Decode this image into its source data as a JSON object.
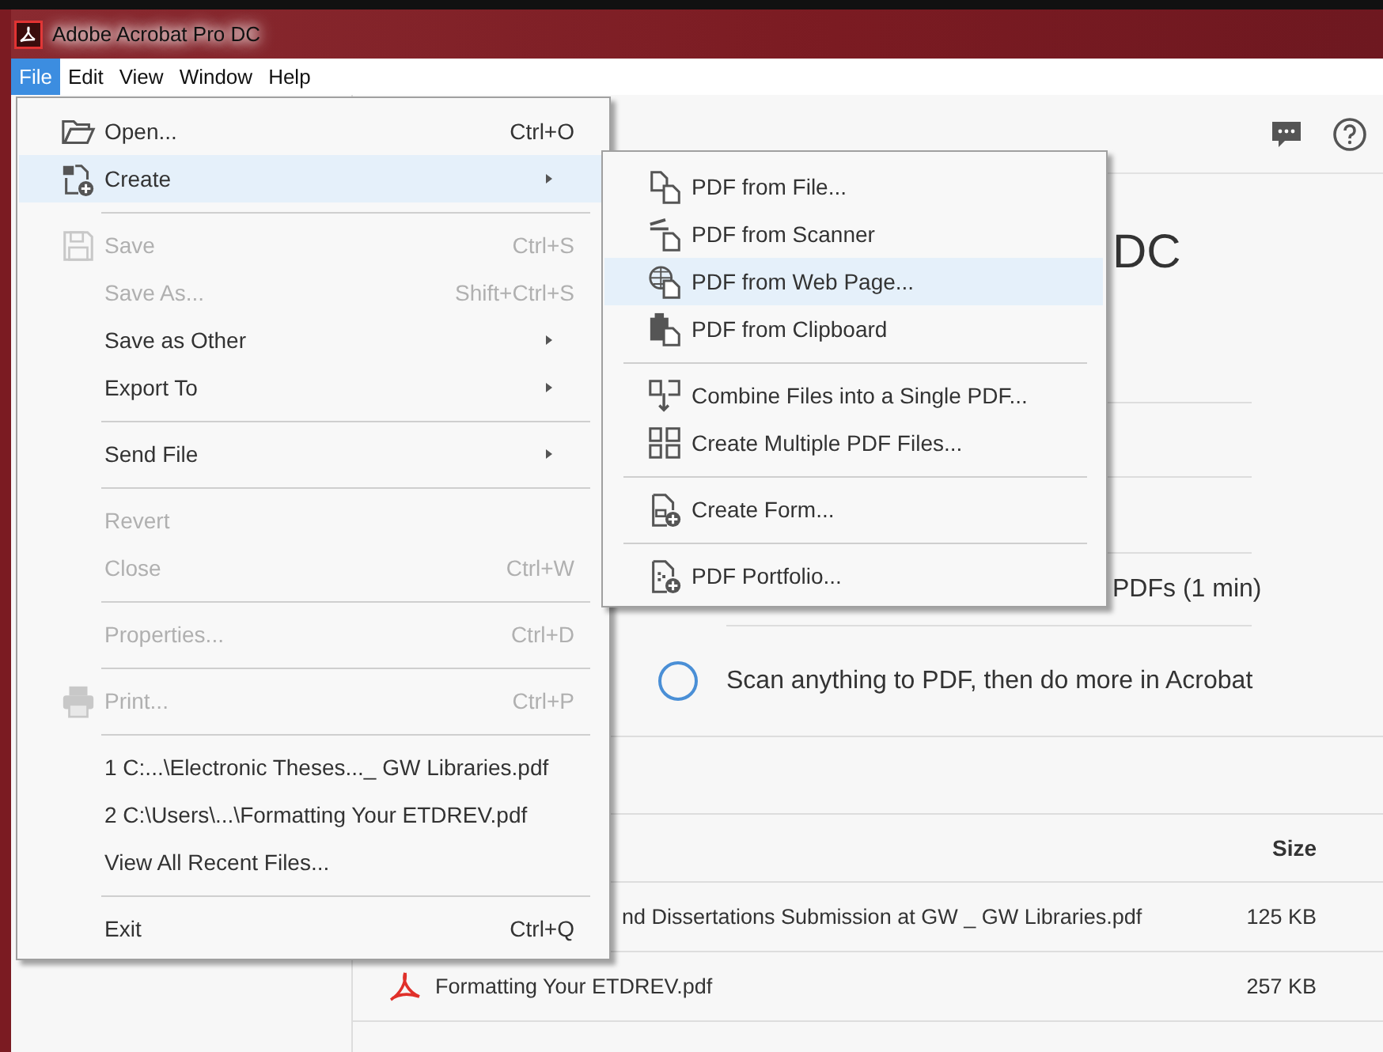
{
  "window": {
    "title": "Adobe Acrobat Pro DC"
  },
  "menubar": [
    {
      "label": "File",
      "selected": true
    },
    {
      "label": "Edit",
      "selected": false
    },
    {
      "label": "View",
      "selected": false
    },
    {
      "label": "Window",
      "selected": false
    },
    {
      "label": "Help",
      "selected": false
    }
  ],
  "file_menu": [
    {
      "kind": "item",
      "label": "Open...",
      "shortcut": "Ctrl+O",
      "submenu": false,
      "disabled": false,
      "selected": false
    },
    {
      "kind": "item",
      "label": "Create",
      "submenu": true,
      "disabled": false,
      "selected": true
    },
    {
      "kind": "separator"
    },
    {
      "kind": "item",
      "label": "Save",
      "shortcut": "Ctrl+S",
      "submenu": false,
      "disabled": true,
      "selected": false
    },
    {
      "kind": "item",
      "label": "Save As...",
      "shortcut": "Shift+Ctrl+S",
      "submenu": false,
      "disabled": true,
      "selected": false
    },
    {
      "kind": "item",
      "label": "Save as Other",
      "submenu": true,
      "disabled": false,
      "selected": false
    },
    {
      "kind": "item",
      "label": "Export To",
      "submenu": true,
      "disabled": false,
      "selected": false
    },
    {
      "kind": "separator"
    },
    {
      "kind": "item",
      "label": "Send File",
      "submenu": true,
      "disabled": false,
      "selected": false
    },
    {
      "kind": "separator"
    },
    {
      "kind": "item",
      "label": "Revert",
      "submenu": false,
      "disabled": true,
      "selected": false
    },
    {
      "kind": "item",
      "label": "Close",
      "shortcut": "Ctrl+W",
      "submenu": false,
      "disabled": true,
      "selected": false
    },
    {
      "kind": "separator"
    },
    {
      "kind": "item",
      "label": "Properties...",
      "shortcut": "Ctrl+D",
      "submenu": false,
      "disabled": true,
      "selected": false
    },
    {
      "kind": "separator"
    },
    {
      "kind": "item",
      "label": "Print...",
      "shortcut": "Ctrl+P",
      "submenu": false,
      "disabled": true,
      "selected": false
    },
    {
      "kind": "separator"
    },
    {
      "kind": "item",
      "label": "1 C:...\\Electronic Theses..._ GW Libraries.pdf",
      "submenu": false,
      "disabled": false,
      "selected": false
    },
    {
      "kind": "item",
      "label": "2 C:\\Users\\...\\Formatting Your ETDREV.pdf",
      "submenu": false,
      "disabled": false,
      "selected": false
    },
    {
      "kind": "item",
      "label": "View All Recent Files...",
      "submenu": false,
      "disabled": false,
      "selected": false
    },
    {
      "kind": "separator"
    },
    {
      "kind": "item",
      "label": "Exit",
      "shortcut": "Ctrl+Q",
      "submenu": false,
      "disabled": false,
      "selected": false
    }
  ],
  "create_submenu": [
    {
      "kind": "item",
      "label": "PDF from File...",
      "selected": false
    },
    {
      "kind": "item",
      "label": "PDF from Scanner",
      "selected": false
    },
    {
      "kind": "item",
      "label": "PDF from Web Page...",
      "selected": true
    },
    {
      "kind": "item",
      "label": "PDF from Clipboard",
      "selected": false
    },
    {
      "kind": "separator"
    },
    {
      "kind": "item",
      "label": "Combine Files into a Single PDF...",
      "selected": false
    },
    {
      "kind": "item",
      "label": "Create Multiple PDF Files...",
      "selected": false
    },
    {
      "kind": "separator"
    },
    {
      "kind": "item",
      "label": "Create Form...",
      "selected": false
    },
    {
      "kind": "separator"
    },
    {
      "kind": "item",
      "label": "PDF Portfolio...",
      "selected": false
    }
  ],
  "home": {
    "heading": "DC",
    "task": "PDFs (1 min)",
    "scan_task": "Scan anything to PDF, then do more in Acrobat"
  },
  "recent_files": {
    "columns": [
      {
        "label": "Size"
      }
    ],
    "rows": [
      {
        "kind": "partial",
        "name": "nd Dissertations Submission at GW _ GW Libraries.pdf",
        "size": "125 KB"
      },
      {
        "kind": "pdf",
        "name": "Formatting Your ETDREV.pdf",
        "size": "257 KB"
      }
    ]
  }
}
